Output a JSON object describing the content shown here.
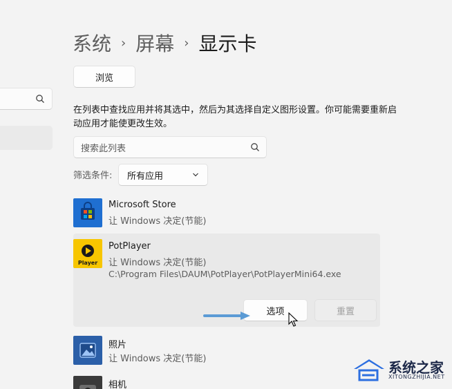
{
  "breadcrumb": {
    "items": [
      "系统",
      "屏幕"
    ],
    "current": "显示卡",
    "separator": "›"
  },
  "browse_button": "浏览",
  "description": "在列表中查找应用并将其选中，然后为其选择自定义图形设置。你可能需要重新启动应用才能使更改生效。",
  "list_search": {
    "placeholder": "搜索此列表"
  },
  "filter": {
    "label": "筛选条件:",
    "selected": "所有应用"
  },
  "apps": [
    {
      "name": "Microsoft Store",
      "setting": "让 Windows 决定(节能)",
      "icon": "microsoft-store-icon"
    },
    {
      "name": "PotPlayer",
      "setting": "让 Windows 决定(节能)",
      "path": "C:\\Program Files\\DAUM\\PotPlayer\\PotPlayerMini64.exe",
      "icon": "potplayer-icon",
      "icon_text": "Player"
    },
    {
      "name": "照片",
      "setting": "让 Windows 决定(节能)",
      "icon": "photos-icon"
    },
    {
      "name": "相机",
      "icon": "camera-icon"
    }
  ],
  "actions": {
    "options": "选项",
    "reset": "重置"
  },
  "watermark": {
    "title": "系统之家",
    "url": "XITONGZHIJIA.NET"
  },
  "colors": {
    "accent": "#4a90e2",
    "ms_store": "#1f6fd1",
    "potplayer": "#f7c600",
    "photos": "#2b5fa8"
  }
}
